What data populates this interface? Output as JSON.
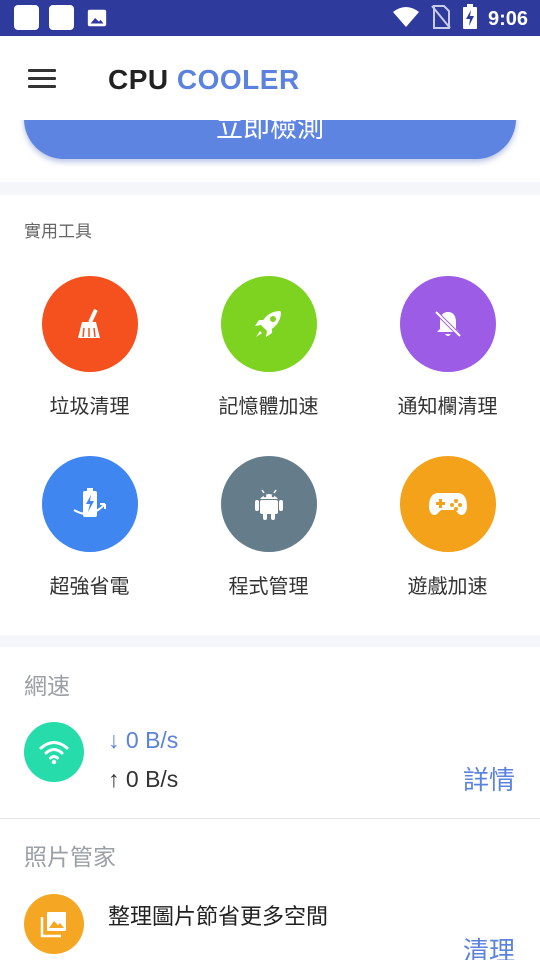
{
  "status_bar": {
    "time": "9:06",
    "left_icons": [
      "notification-square-icon",
      "notification-square-icon",
      "image-icon"
    ],
    "right_icons": [
      "wifi-icon",
      "no-sim-icon",
      "battery-charging-icon"
    ]
  },
  "app_bar": {
    "title_part1": "CPU",
    "title_part2": "COOLER",
    "menu_icon": "hamburger-menu-icon"
  },
  "scan_button": {
    "label": "立即檢測"
  },
  "tools": {
    "title": "實用工具",
    "items": [
      {
        "label": "垃圾清理",
        "icon": "broom-icon",
        "color": "#f4511e"
      },
      {
        "label": "記憶體加速",
        "icon": "rocket-icon",
        "color": "#7ed321"
      },
      {
        "label": "通知欄清理",
        "icon": "bell-off-icon",
        "color": "#9c5ce6"
      },
      {
        "label": "超強省電",
        "icon": "battery-saver-icon",
        "color": "#3f86f0"
      },
      {
        "label": "程式管理",
        "icon": "android-icon",
        "color": "#657d8b"
      },
      {
        "label": "遊戲加速",
        "icon": "gamepad-icon",
        "color": "#f5a21b"
      }
    ]
  },
  "network": {
    "title": "網速",
    "download": "↓ 0 B/s",
    "upload": "↑ 0 B/s",
    "details_label": "詳情"
  },
  "photos": {
    "title": "照片管家",
    "description": "整理圖片節省更多空間",
    "clean_label": "清理"
  },
  "colors": {
    "status_bar": "#2f3b9c",
    "accent": "#5b82dd",
    "scan_button": "#5e84e2",
    "wifi_circle": "#25dcaa",
    "photo_circle": "#f5a623"
  }
}
